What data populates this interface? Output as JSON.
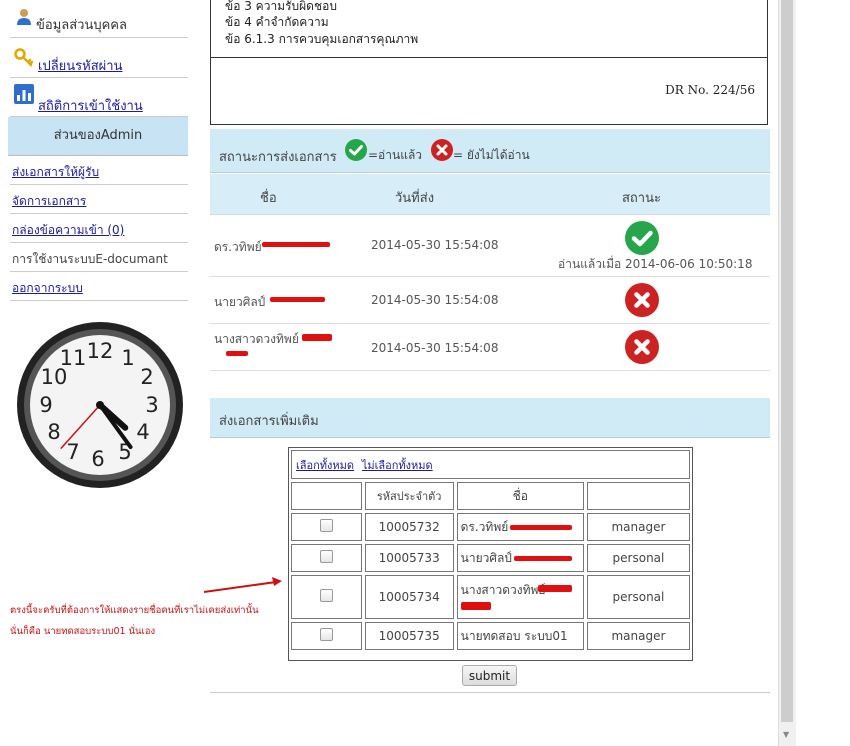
{
  "sidebar": {
    "personal_info": "ข้อมูลส่วนบุคคล",
    "change_password": "เปลี่ยนรหัสผ่าน",
    "usage_stats": "สถิติการเข้าใช้งาน",
    "admin_section": "ส่วนของAdmin",
    "links": [
      "ส่งเอกสารให้ผู้รับ",
      "จัดการเอกสาร",
      "กล่องข้อความเข้า (0)",
      "การใช้งานระบบE-documant",
      "ออกจากระบบ"
    ]
  },
  "doc": {
    "lines": [
      "ข้อ 3 ความรับผิดชอบ",
      "ข้อ 4 คำจำกัดความ",
      "ข้อ 6.1.3 การควบคุมเอกสารคุณภาพ"
    ],
    "dr_no": "DR No. 224/56"
  },
  "status": {
    "title": "สถานะการส่งเอกสาร",
    "read_legend": "=อ่านแล้ว",
    "unread_legend": "= ยังไม่ได้อ่าน",
    "headers": [
      "ชื่อ",
      "วันที่ส่ง",
      "สถานะ"
    ],
    "rows": [
      {
        "name": "ดร.วทิพย์",
        "date": "2014-05-30 15:54:08",
        "status": "read",
        "read_at": "อ่านแล้วเมื่อ 2014-06-06 10:50:18"
      },
      {
        "name": "นายวศิลป์",
        "date": "2014-05-30 15:54:08",
        "status": "unread",
        "read_at": ""
      },
      {
        "name": "นางสาวดวงทิพย์",
        "date": "2014-05-30 15:54:08",
        "status": "unread",
        "read_at": ""
      }
    ]
  },
  "more": {
    "title": "ส่งเอกสารเพิ่มเติม",
    "select_all": "เลือกทั้งหมด",
    "deselect_all": "ไม่เลือกทั้งหมด",
    "headers": [
      "",
      "รหัสประจำตัว",
      "ชื่อ",
      ""
    ],
    "rows": [
      {
        "id": "10005732",
        "name": "ดร.วทิพย์",
        "role": "manager"
      },
      {
        "id": "10005733",
        "name": "นายวศิลป์",
        "role": "personal"
      },
      {
        "id": "10005734",
        "name": "นางสาวดวงทิพย์",
        "role": "personal"
      },
      {
        "id": "10005735",
        "name": "นายทดสอบ ระบบ01",
        "role": "manager"
      }
    ],
    "submit": "submit"
  },
  "annotation": {
    "line1": "ตรงนี้จะครับที่ต้องการให้แสดงรายชื่อคนที่เราไม่เคยส่งเท่านั้น",
    "line2": "นั่นก็คือ นายทดสอบระบบ01 นั่นเอง"
  },
  "colors": {
    "link": "#1a1aa6",
    "section_bg": "#d0eaf6",
    "read": "#26a64a",
    "unread": "#cc2222",
    "annotation": "#cc1111"
  },
  "clock": {
    "hour": 4,
    "minute": 24,
    "second": 37
  }
}
